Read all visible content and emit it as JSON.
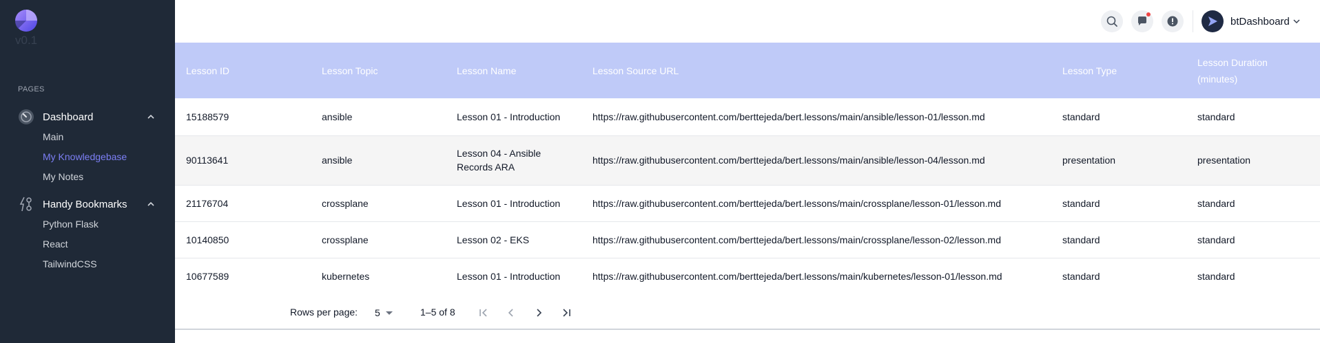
{
  "sidebar": {
    "version": "v0.1",
    "section_label": "PAGES",
    "groups": [
      {
        "label": "Dashboard",
        "icon": "dashboard-icon",
        "items": [
          {
            "label": "Main",
            "active": false
          },
          {
            "label": "My Knowledgebase",
            "active": true
          },
          {
            "label": "My Notes",
            "active": false
          }
        ]
      },
      {
        "label": "Handy Bookmarks",
        "icon": "bookmark-icon",
        "items": [
          {
            "label": "Python Flask",
            "active": false
          },
          {
            "label": "React",
            "active": false
          },
          {
            "label": "TailwindCSS",
            "active": false
          }
        ]
      }
    ]
  },
  "header": {
    "icons": [
      "search-icon",
      "chat-icon",
      "alert-icon"
    ],
    "user_name": "btDashboard"
  },
  "table": {
    "columns": [
      "Lesson ID",
      "Lesson Topic",
      "Lesson Name",
      "Lesson Source URL",
      "Lesson Type",
      "Lesson Duration (minutes)"
    ],
    "rows": [
      [
        "15188579",
        "ansible",
        "Lesson 01 - Introduction",
        "https://raw.githubusercontent.com/berttejeda/bert.lessons/main/ansible/lesson-01/lesson.md",
        "standard",
        "standard"
      ],
      [
        "90113641",
        "ansible",
        "Lesson 04 - Ansible Records ARA",
        "https://raw.githubusercontent.com/berttejeda/bert.lessons/main/ansible/lesson-04/lesson.md",
        "presentation",
        "presentation"
      ],
      [
        "21176704",
        "crossplane",
        "Lesson 01 - Introduction",
        "https://raw.githubusercontent.com/berttejeda/bert.lessons/main/crossplane/lesson-01/lesson.md",
        "standard",
        "standard"
      ],
      [
        "10140850",
        "crossplane",
        "Lesson 02 - EKS",
        "https://raw.githubusercontent.com/berttejeda/bert.lessons/main/crossplane/lesson-02/lesson.md",
        "standard",
        "standard"
      ],
      [
        "10677589",
        "kubernetes",
        "Lesson 01 - Introduction",
        "https://raw.githubusercontent.com/berttejeda/bert.lessons/main/kubernetes/lesson-01/lesson.md",
        "standard",
        "standard"
      ]
    ]
  },
  "pagination": {
    "rows_per_page_label": "Rows per page:",
    "rows_per_page_value": "5",
    "range_text": "1–5 of 8"
  },
  "colors": {
    "sidebar_bg": "#1f2937",
    "header_row_bg": "#bfcaf8",
    "active_link": "#7c7ff5"
  }
}
